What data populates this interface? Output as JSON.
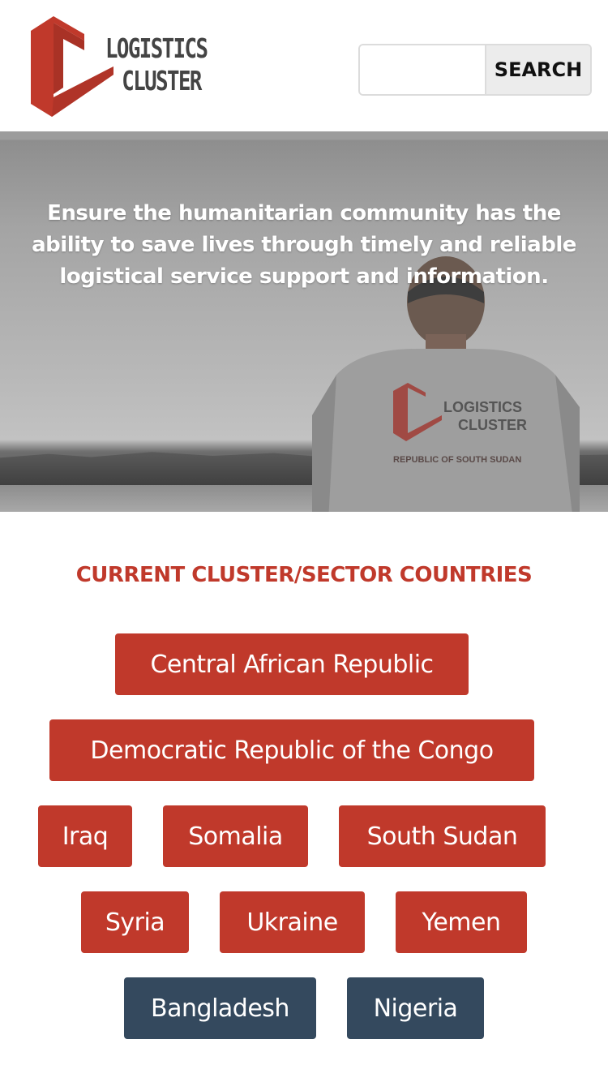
{
  "header": {
    "logo_line1": "LOGISTICS",
    "logo_line2": "CLUSTER",
    "search_placeholder": "",
    "search_button": "SEARCH"
  },
  "hero": {
    "tagline": "Ensure the humanitarian community has the ability to save lives through timely and reliable logistical service support and information.",
    "shirt_line1": "LOGISTICS",
    "shirt_line2": "CLUSTER",
    "shirt_line3": "REPUBLIC OF SOUTH SUDAN"
  },
  "countries": {
    "title": "CURRENT CLUSTER/SECTOR COUNTRIES",
    "items": [
      {
        "label": "Central African Republic",
        "variant": "red"
      },
      {
        "label": "Democratic Republic of the Congo",
        "variant": "red"
      },
      {
        "label": "Iraq",
        "variant": "red"
      },
      {
        "label": "Somalia",
        "variant": "red"
      },
      {
        "label": "South Sudan",
        "variant": "red"
      },
      {
        "label": "Syria",
        "variant": "red"
      },
      {
        "label": "Ukraine",
        "variant": "red"
      },
      {
        "label": "Yemen",
        "variant": "red"
      },
      {
        "label": "Bangladesh",
        "variant": "navy"
      },
      {
        "label": "Nigeria",
        "variant": "navy"
      }
    ]
  },
  "colors": {
    "brand_red": "#c0392b",
    "navy": "#34495e"
  }
}
